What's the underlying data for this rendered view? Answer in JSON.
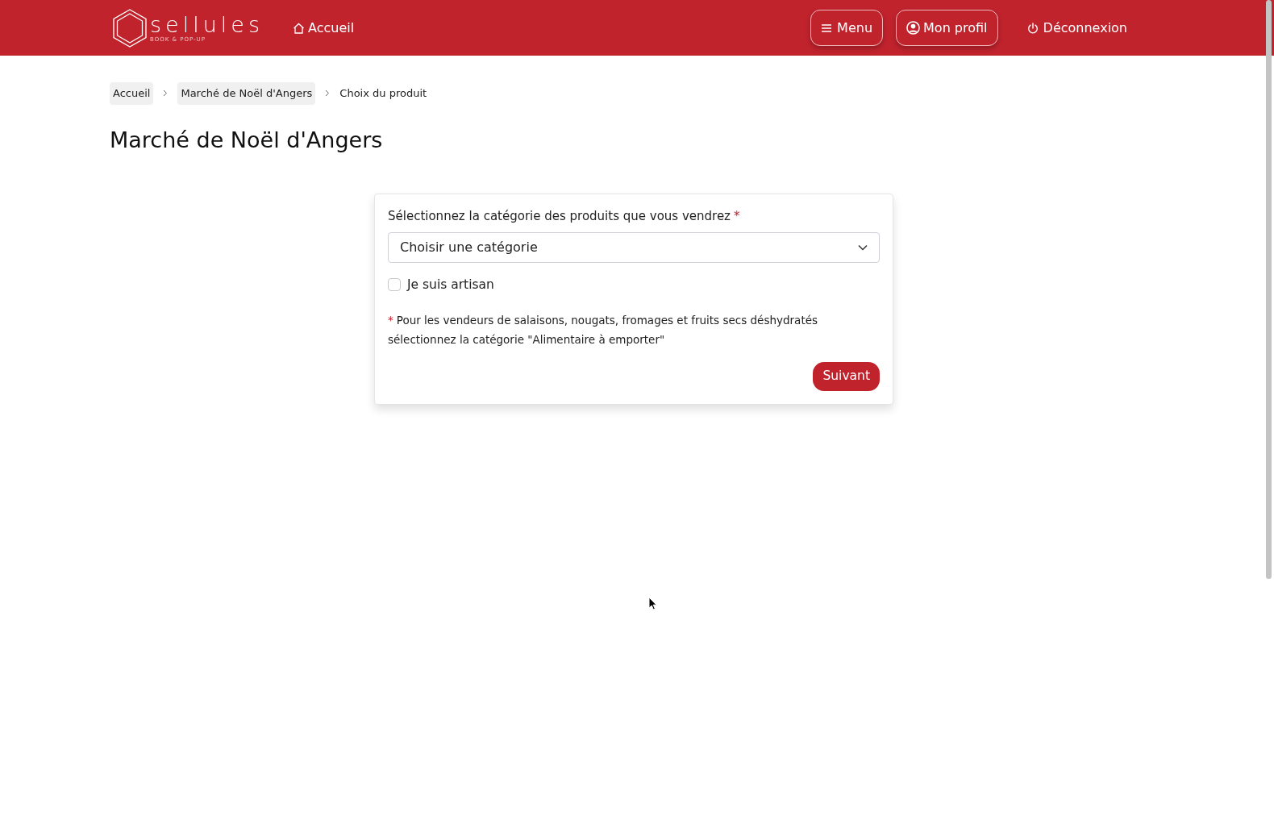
{
  "header": {
    "logo": {
      "name": "sellules",
      "tagline": "BOOK & POP-UP"
    },
    "home_link": "Accueil",
    "buttons": [
      {
        "kind": "menu",
        "label": "Menu",
        "outlined": true
      },
      {
        "kind": "profile",
        "label": "Mon profil",
        "outlined": true
      },
      {
        "kind": "logout",
        "label": "Déconnexion",
        "outlined": false
      }
    ]
  },
  "breadcrumb": [
    {
      "label": "Accueil",
      "link": true
    },
    {
      "label": "Marché de Noël d'Angers",
      "link": true
    },
    {
      "label": "Choix du produit",
      "link": false
    }
  ],
  "title": "Marché de Noël d'Angers",
  "form": {
    "label": "Sélectionnez la catégorie des produits que vous vendrez",
    "required_mark": "*",
    "select": {
      "placeholder": "Choisir une catégorie"
    },
    "checkbox": {
      "label": "Je suis artisan",
      "checked": false
    },
    "note": {
      "mark": "*",
      "line1": "Pour les vendeurs de salaisons, nougats, fromages et fruits secs déshydratés",
      "line2": "sélectionnez la catégorie \"Alimentaire à emporter\""
    },
    "submit": "Suivant"
  }
}
